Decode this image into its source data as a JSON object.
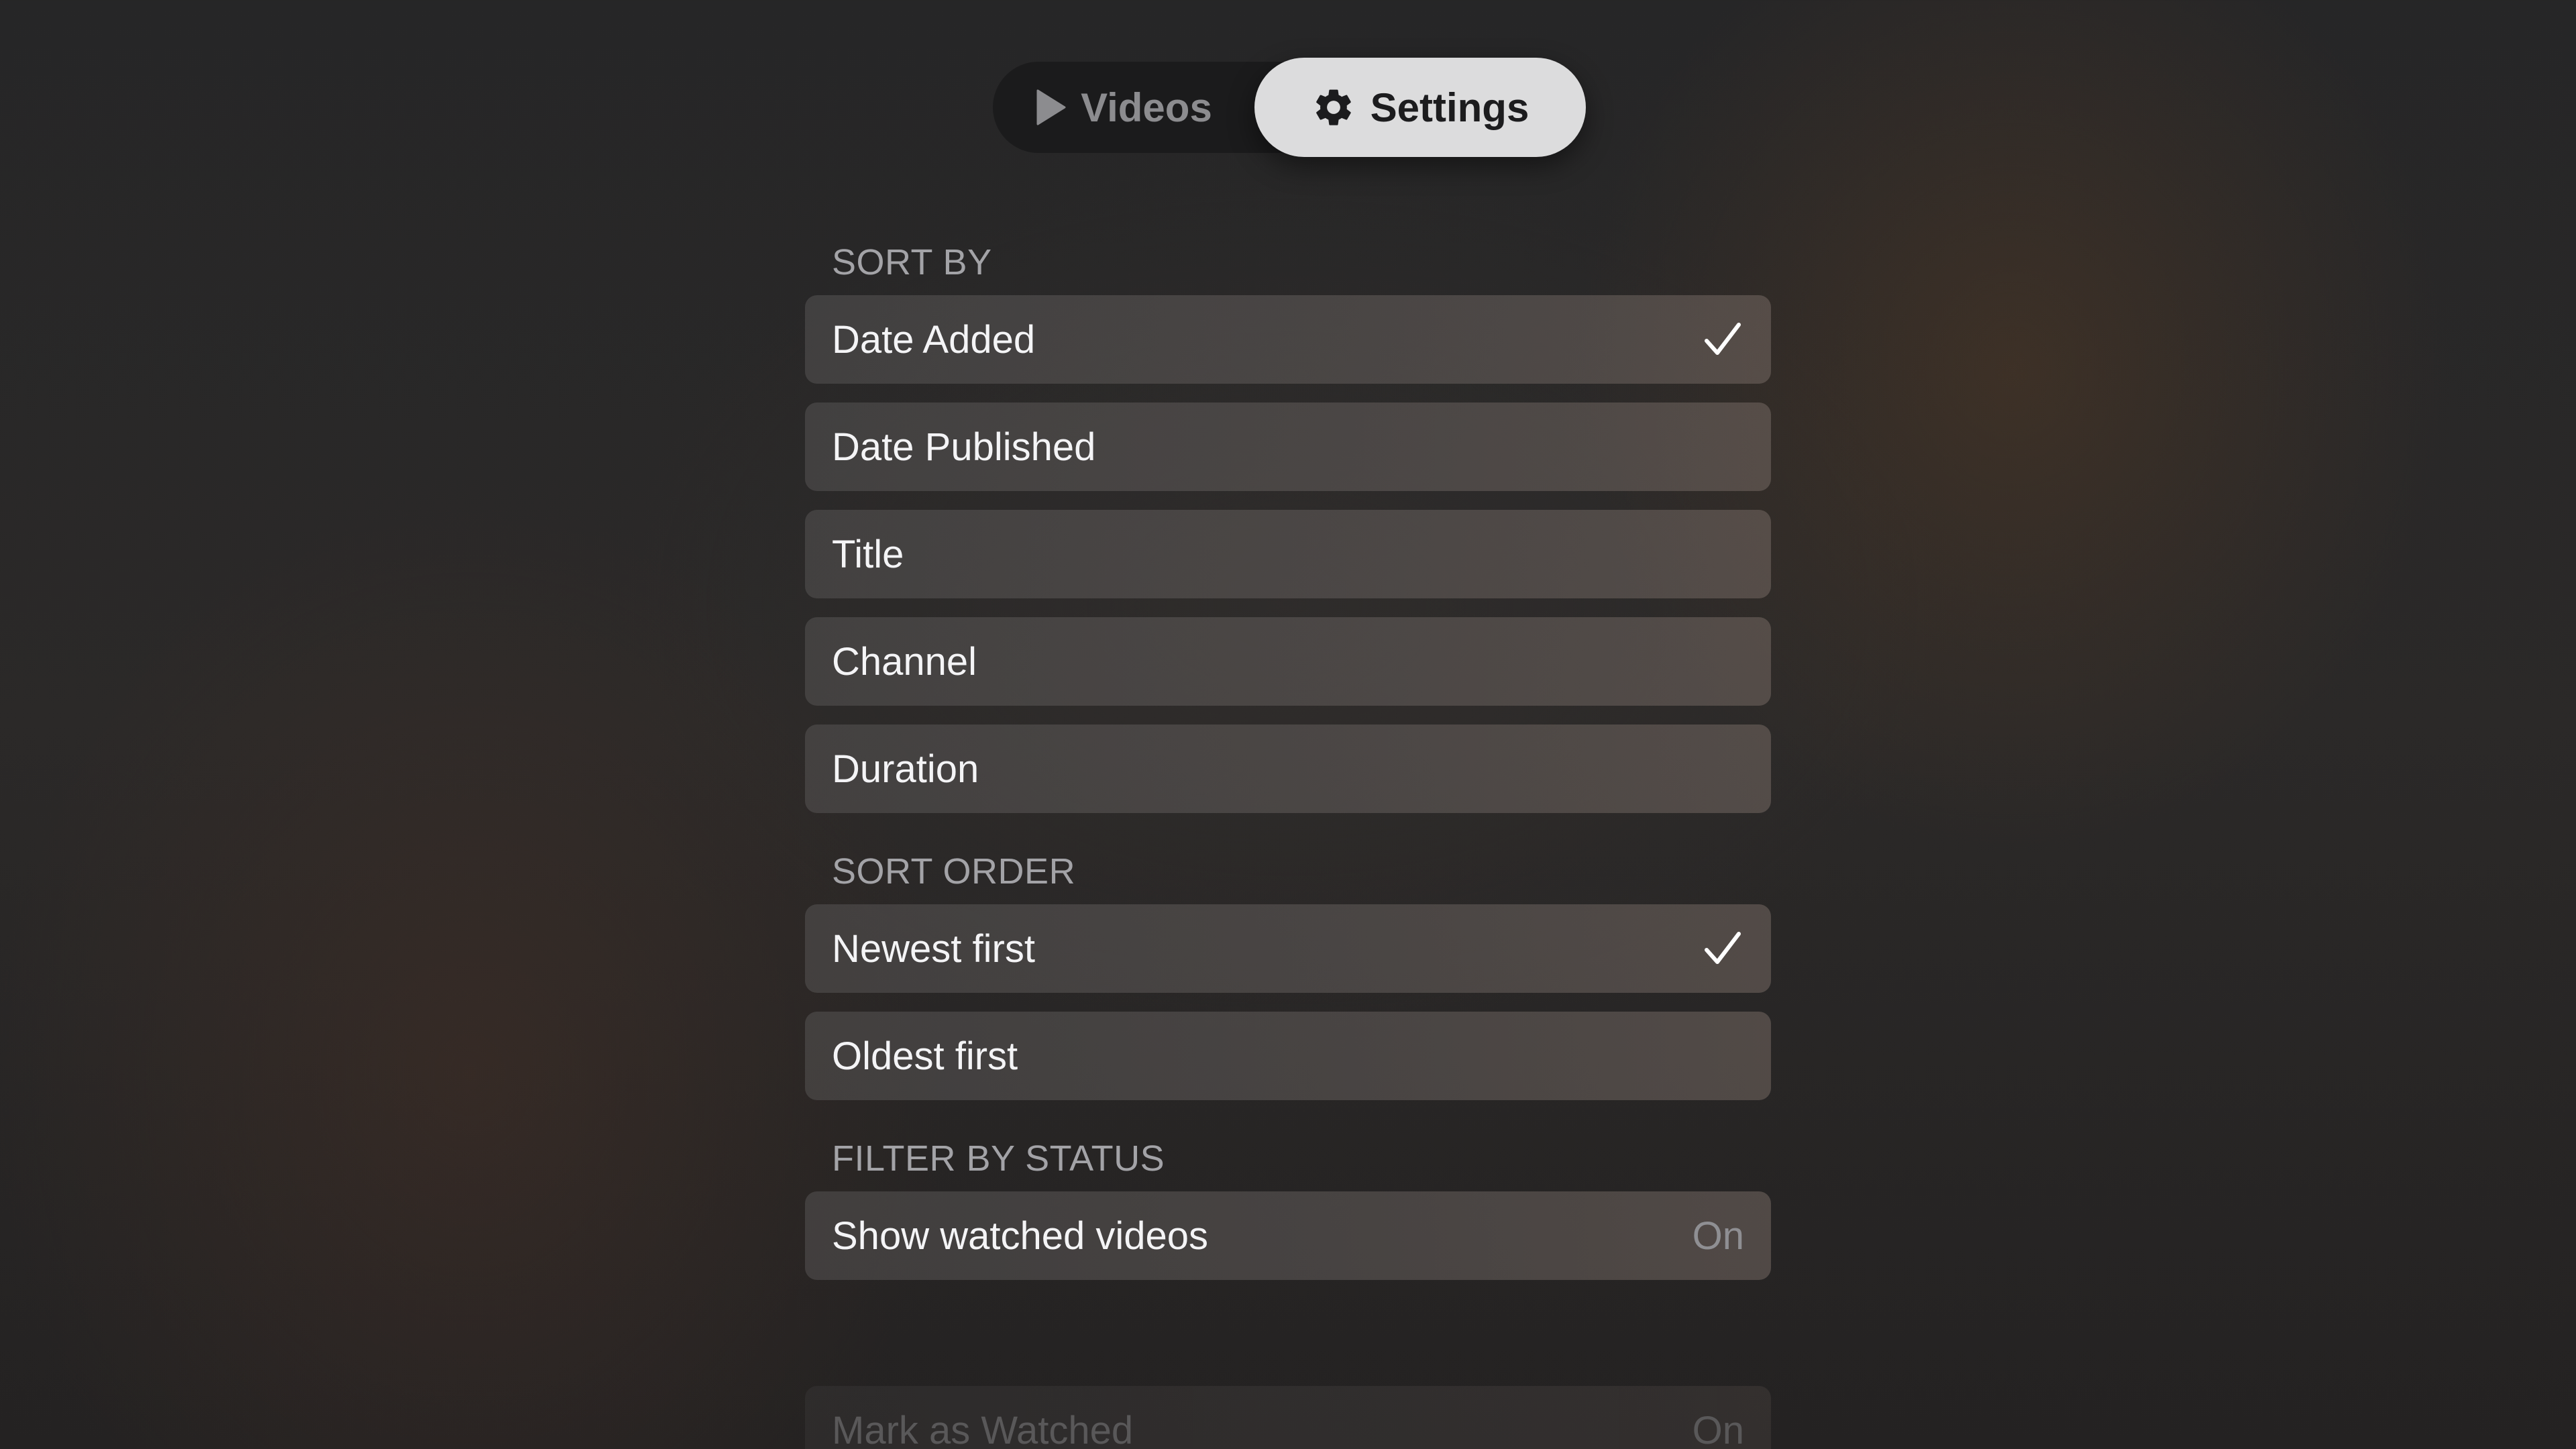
{
  "tabs": {
    "videos_label": "Videos",
    "settings_label": "Settings",
    "selected": "Settings"
  },
  "sections": {
    "sort_by": {
      "header": "SORT BY",
      "items": [
        {
          "label": "Date Added",
          "checked": true
        },
        {
          "label": "Date Published",
          "checked": false
        },
        {
          "label": "Title",
          "checked": false
        },
        {
          "label": "Channel",
          "checked": false
        },
        {
          "label": "Duration",
          "checked": false
        }
      ]
    },
    "sort_order": {
      "header": "SORT ORDER",
      "items": [
        {
          "label": "Newest first",
          "checked": true
        },
        {
          "label": "Oldest first",
          "checked": false
        }
      ]
    },
    "filter_by_status": {
      "header": "FILTER BY STATUS",
      "items": [
        {
          "label": "Show watched videos",
          "value": "On"
        }
      ]
    },
    "mark_as_watched": {
      "label": "Mark as Watched",
      "value": "On"
    }
  },
  "icons": {
    "videos": "play-icon",
    "settings": "gear-icon",
    "selected_row": "checkmark-icon"
  },
  "colors": {
    "selected_tab_bg": "#dcdcdd",
    "tab_bar_bg": "#1b1b1c",
    "section_header": "#a3a3a7",
    "row_text": "#f4f4f6",
    "value_text": "#8f8f93"
  }
}
